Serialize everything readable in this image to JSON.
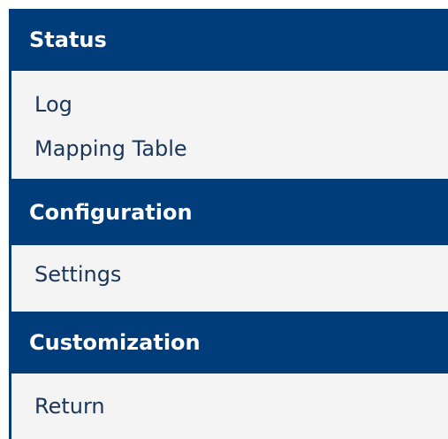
{
  "menu": {
    "sections": [
      {
        "title": "Status",
        "items": [
          "Log",
          "Mapping Table"
        ]
      },
      {
        "title": "Configuration",
        "items": [
          "Settings"
        ]
      },
      {
        "title": "Customization",
        "items": [
          "Return"
        ]
      }
    ]
  },
  "colors": {
    "header_bg": "#003d7a",
    "header_text": "#ffffff",
    "menu_bg": "#f4f4f4",
    "item_text": "#1a3658"
  }
}
